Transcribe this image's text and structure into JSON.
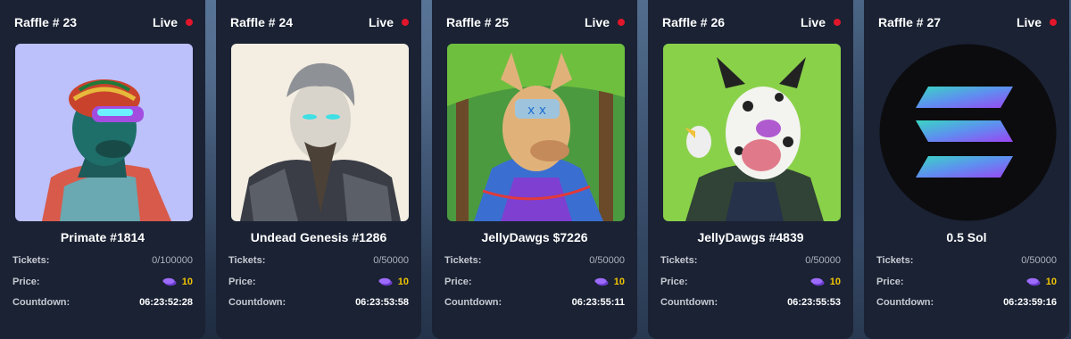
{
  "labels": {
    "tickets": "Tickets:",
    "price": "Price:",
    "countdown": "Countdown:",
    "live": "Live"
  },
  "colors": {
    "card_bg": "#1a2234",
    "live_dot": "#e0162b",
    "price_value": "#f3c400",
    "token_icon": "#8a5cf0"
  },
  "raffles": [
    {
      "title": "Raffle # 23",
      "name": "Primate #1814",
      "tickets": "0/100000",
      "price": "10",
      "countdown": "06:23:52:28",
      "icon": "ape-nft-image"
    },
    {
      "title": "Raffle # 24",
      "name": "Undead Genesis #1286",
      "tickets": "0/50000",
      "price": "10",
      "countdown": "06:23:53:58",
      "icon": "undead-nft-image"
    },
    {
      "title": "Raffle # 25",
      "name": "JellyDawgs $7226",
      "tickets": "0/50000",
      "price": "10",
      "countdown": "06:23:55:11",
      "icon": "dog-nft-image"
    },
    {
      "title": "Raffle # 26",
      "name": "JellyDawgs #4839",
      "tickets": "0/50000",
      "price": "10",
      "countdown": "06:23:55:53",
      "icon": "dalmatian-nft-image"
    },
    {
      "title": "Raffle # 27",
      "name": "0.5 Sol",
      "tickets": "0/50000",
      "price": "10",
      "countdown": "06:23:59:16",
      "icon": "solana-logo"
    }
  ]
}
